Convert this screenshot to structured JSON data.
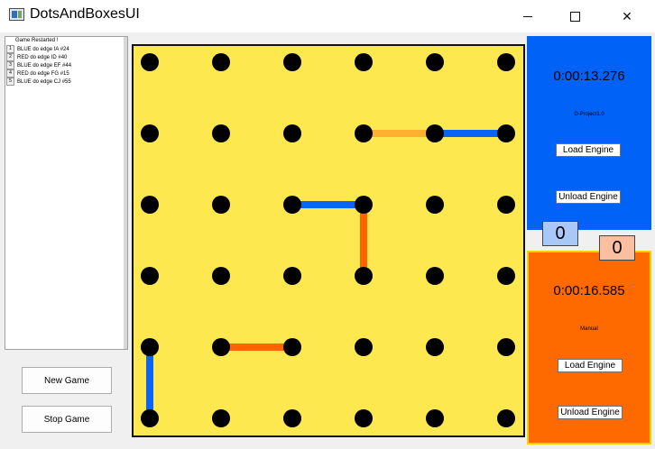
{
  "window": {
    "title": "DotsAndBoxesUI"
  },
  "log": {
    "header": "Game Restarted !",
    "entries": [
      {
        "num": "1",
        "text": "BLUE do edge IA #24"
      },
      {
        "num": "2",
        "text": "RED  do edge ID #40"
      },
      {
        "num": "3",
        "text": "BLUE do edge EF #44"
      },
      {
        "num": "4",
        "text": "RED  do edge FG #15"
      },
      {
        "num": "5",
        "text": "BLUE do edge CJ #55"
      }
    ]
  },
  "controls": {
    "new_game": "New Game",
    "stop_game": "Stop Game"
  },
  "board": {
    "rows": 6,
    "cols": 6,
    "colors": {
      "background": "#fde84f",
      "dot": "#000000",
      "blue": "#0a64f5",
      "red": "#ff6400",
      "orange": "#ffb030"
    },
    "edges": [
      {
        "from": [
          1,
          3
        ],
        "to": [
          1,
          4
        ],
        "color": "orange"
      },
      {
        "from": [
          1,
          4
        ],
        "to": [
          1,
          5
        ],
        "color": "blue"
      },
      {
        "from": [
          2,
          2
        ],
        "to": [
          2,
          3
        ],
        "color": "blue"
      },
      {
        "from": [
          2,
          3
        ],
        "to": [
          3,
          3
        ],
        "color": "red"
      },
      {
        "from": [
          4,
          1
        ],
        "to": [
          4,
          2
        ],
        "color": "red"
      },
      {
        "from": [
          4,
          0
        ],
        "to": [
          5,
          0
        ],
        "color": "blue"
      }
    ]
  },
  "blue_player": {
    "timer": "0:00:13.276",
    "engine": "D-Project1.0",
    "load": "Load Engine",
    "unload": "Unload Engine",
    "score": "0",
    "color": "#0062f7"
  },
  "red_player": {
    "timer": "0:00:16.585",
    "engine": "Manual",
    "load": "Load Engine",
    "unload": "Unload Engine",
    "score": "0",
    "color": "#ff6a00"
  }
}
